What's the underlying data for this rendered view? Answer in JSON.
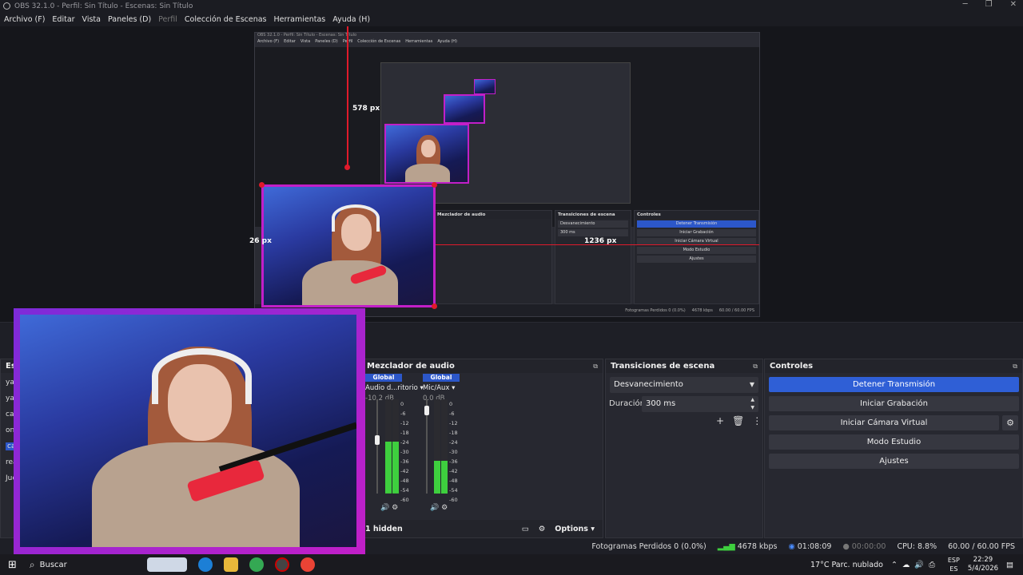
{
  "window": {
    "title": "OBS 32.1.0 - Perfil: Sin Título - Escenas: Sin Título"
  },
  "menu": [
    "Archivo (F)",
    "Editar",
    "Vista",
    "Paneles (D)",
    "Perfil",
    "Colección de Escenas",
    "Herramientas",
    "Ayuda (H)"
  ],
  "guides": {
    "vertical_label": "578 px",
    "horizontal_label": "1236 px",
    "left_label": "26 px"
  },
  "docks": {
    "scenes_stub": "Esc",
    "mixer_title": "Mezclador de audio",
    "transitions_title": "Transiciones de escena",
    "controls_title": "Controles"
  },
  "mixer": {
    "channels": [
      {
        "global": "Global",
        "name": "Audio d...ritorio",
        "db": "-10.2 dB",
        "level": 0.55
      },
      {
        "global": "Global",
        "name": "Mic/Aux",
        "db": "0.0 dB",
        "level": 0.35
      }
    ],
    "scale": [
      "0",
      "-6",
      "-12",
      "-18",
      "-24",
      "-30",
      "-36",
      "-42",
      "-48",
      "-54",
      "-60"
    ],
    "hidden_label": "1 hidden",
    "options_label": "Options"
  },
  "transitions": {
    "selected": "Desvanecimiento",
    "duration_label": "Duración",
    "duration_value": "300 ms"
  },
  "controls": {
    "stop_stream": "Detener Transmisión",
    "start_recording": "Iniciar Grabación",
    "start_virtual_cam": "Iniciar Cámara Virtual",
    "studio_mode": "Modo Estudio",
    "settings": "Ajustes"
  },
  "scene_stub_items": [
    "ya",
    "ya",
    "ca",
    "on",
    "ca",
    "rea",
    "Jue"
  ],
  "status": {
    "dropped_frames": "Fotogramas Perdidos 0 (0.0%)",
    "bitrate": "4678 kbps",
    "stream_time": "01:08:09",
    "rec_time": "00:00:00",
    "cpu": "CPU: 8.8%",
    "fps": "60.00 / 60.00 FPS"
  },
  "taskbar": {
    "search_label": "Buscar",
    "weather": "17°C  Parc. nublado",
    "lang_top": "ESP",
    "lang_bottom": "ES",
    "time": "22:29",
    "date": "5/4/2026"
  },
  "nested": {
    "controls": [
      "Detener Transmisión",
      "Iniciar Grabación",
      "Iniciar Cámara Virtual",
      "Modo Estudio",
      "Ajustes"
    ],
    "mixer_title": "Mezclador de audio",
    "transitions_title": "Transiciones de escena",
    "controls_title": "Controles",
    "transition": "Desvanecimiento",
    "duration": "300 ms"
  },
  "colors": {
    "accent": "#2f5fd6",
    "guide": "#e01a2b",
    "frame": "#b01ad0"
  }
}
